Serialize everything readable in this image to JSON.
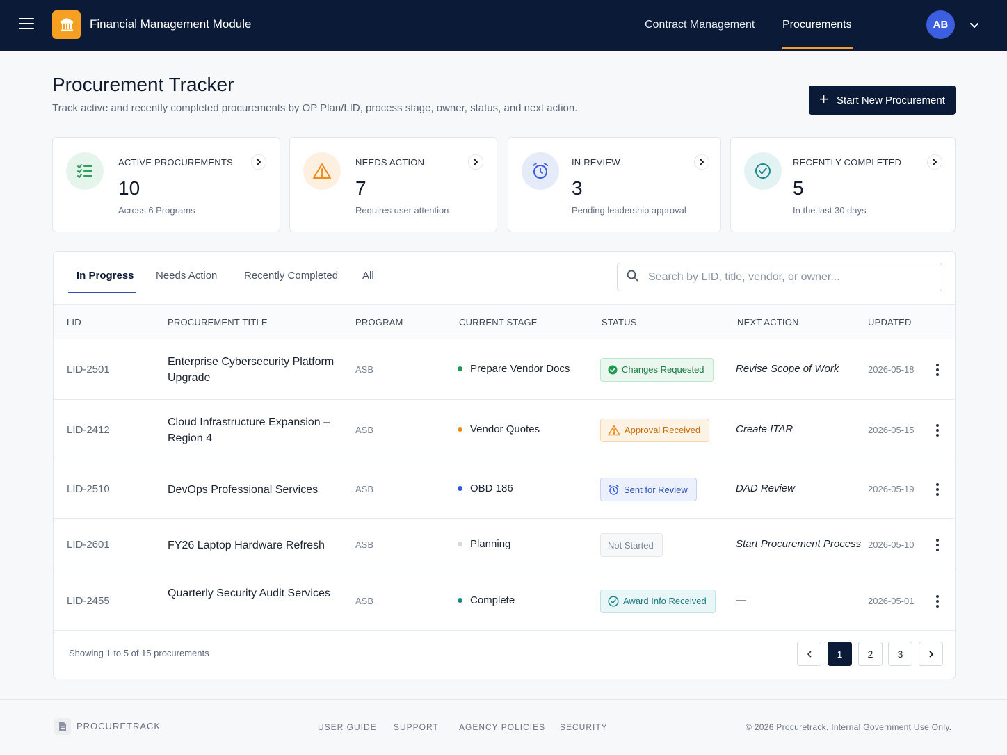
{
  "header": {
    "app_title": "Financial Management Module",
    "nav": [
      {
        "label": "Contract Management"
      },
      {
        "label": "Procurements"
      }
    ],
    "avatar_initials": "AB"
  },
  "page": {
    "title": "Procurement Tracker",
    "subtitle": "Track active and recently completed procurements by OP Plan/LID, process stage, owner, status, and next action.",
    "primary_button": "Start New Procurement"
  },
  "stats": [
    {
      "label": "ACTIVE PROCUREMENTS",
      "value": "10",
      "caption": "Across 6 Programs",
      "icon": "checklist-icon",
      "color": "#2f9e5f"
    },
    {
      "label": "NEEDS ACTION",
      "value": "7",
      "caption": "Requires user attention",
      "icon": "warning-icon",
      "color": "#f08c1a"
    },
    {
      "label": "IN REVIEW",
      "value": "3",
      "caption": "Pending leadership approval",
      "icon": "alarm-clock-icon",
      "color": "#3b5fe0"
    },
    {
      "label": "RECENTLY COMPLETED",
      "value": "5",
      "caption": "In the last 30 days",
      "icon": "check-circle-icon",
      "color": "#1e8a8a"
    }
  ],
  "tabs": [
    {
      "label": "In Progress"
    },
    {
      "label": "Needs Action"
    },
    {
      "label": "Recently Completed"
    },
    {
      "label": "All"
    }
  ],
  "search": {
    "placeholder": "Search by LID, title, vendor, or owner..."
  },
  "table": {
    "headers": [
      "LID",
      "PROCUREMENT TITLE",
      "PROGRAM",
      "CURRENT STAGE",
      "STATUS",
      "NEXT ACTION",
      "UPDATED"
    ],
    "rows": [
      {
        "lid": "LID-2501",
        "title": "Enterprise Cybersecurity Platform Upgrade",
        "program": "ASB",
        "stage": "Prepare Vendor Docs",
        "stage_color": "#1f9a4f",
        "status": "Changes Requested",
        "status_kind": "green",
        "next_action": "Revise Scope of Work",
        "updated": "2026-05-18"
      },
      {
        "lid": "LID-2412",
        "title": "Cloud Infrastructure Expansion – Region 4",
        "program": "ASB",
        "stage": "Vendor Quotes",
        "stage_color": "#f08c1a",
        "status": "Approval Received",
        "status_kind": "orange",
        "next_action": "Create ITAR",
        "updated": "2026-05-15"
      },
      {
        "lid": "LID-2510",
        "title": "DevOps Professional Services",
        "program": "ASB",
        "stage": "OBD 186",
        "stage_color": "#2c57d8",
        "status": "Sent for Review",
        "status_kind": "blue",
        "next_action": "DAD Review",
        "updated": "2026-05-19"
      },
      {
        "lid": "LID-2601",
        "title": "FY26 Laptop Hardware Refresh",
        "program": "ASB",
        "stage": "Planning",
        "stage_color": "#d4d8de",
        "status": "Not Started",
        "status_kind": "gray",
        "next_action": "Start Procurement Process",
        "updated": "2026-05-10"
      },
      {
        "lid": "LID-2455",
        "title": "Quarterly Security Audit Services",
        "program": "ASB",
        "stage": "Complete",
        "stage_color": "#1a8a8a",
        "status": "Award Info Received",
        "status_kind": "teal",
        "next_action": "—",
        "updated": "2026-05-01"
      }
    ]
  },
  "pagination": {
    "showing": "Showing 1 to 5 of 15 procurements",
    "pages": [
      "1",
      "2",
      "3"
    ],
    "current": "1"
  },
  "footer": {
    "brand": "PROCURETRACK",
    "links": [
      "USER GUIDE",
      "SUPPORT",
      "AGENCY POLICIES",
      "SECURITY"
    ],
    "copyright": "© 2026 Procuretrack. Internal Government Use Only."
  }
}
